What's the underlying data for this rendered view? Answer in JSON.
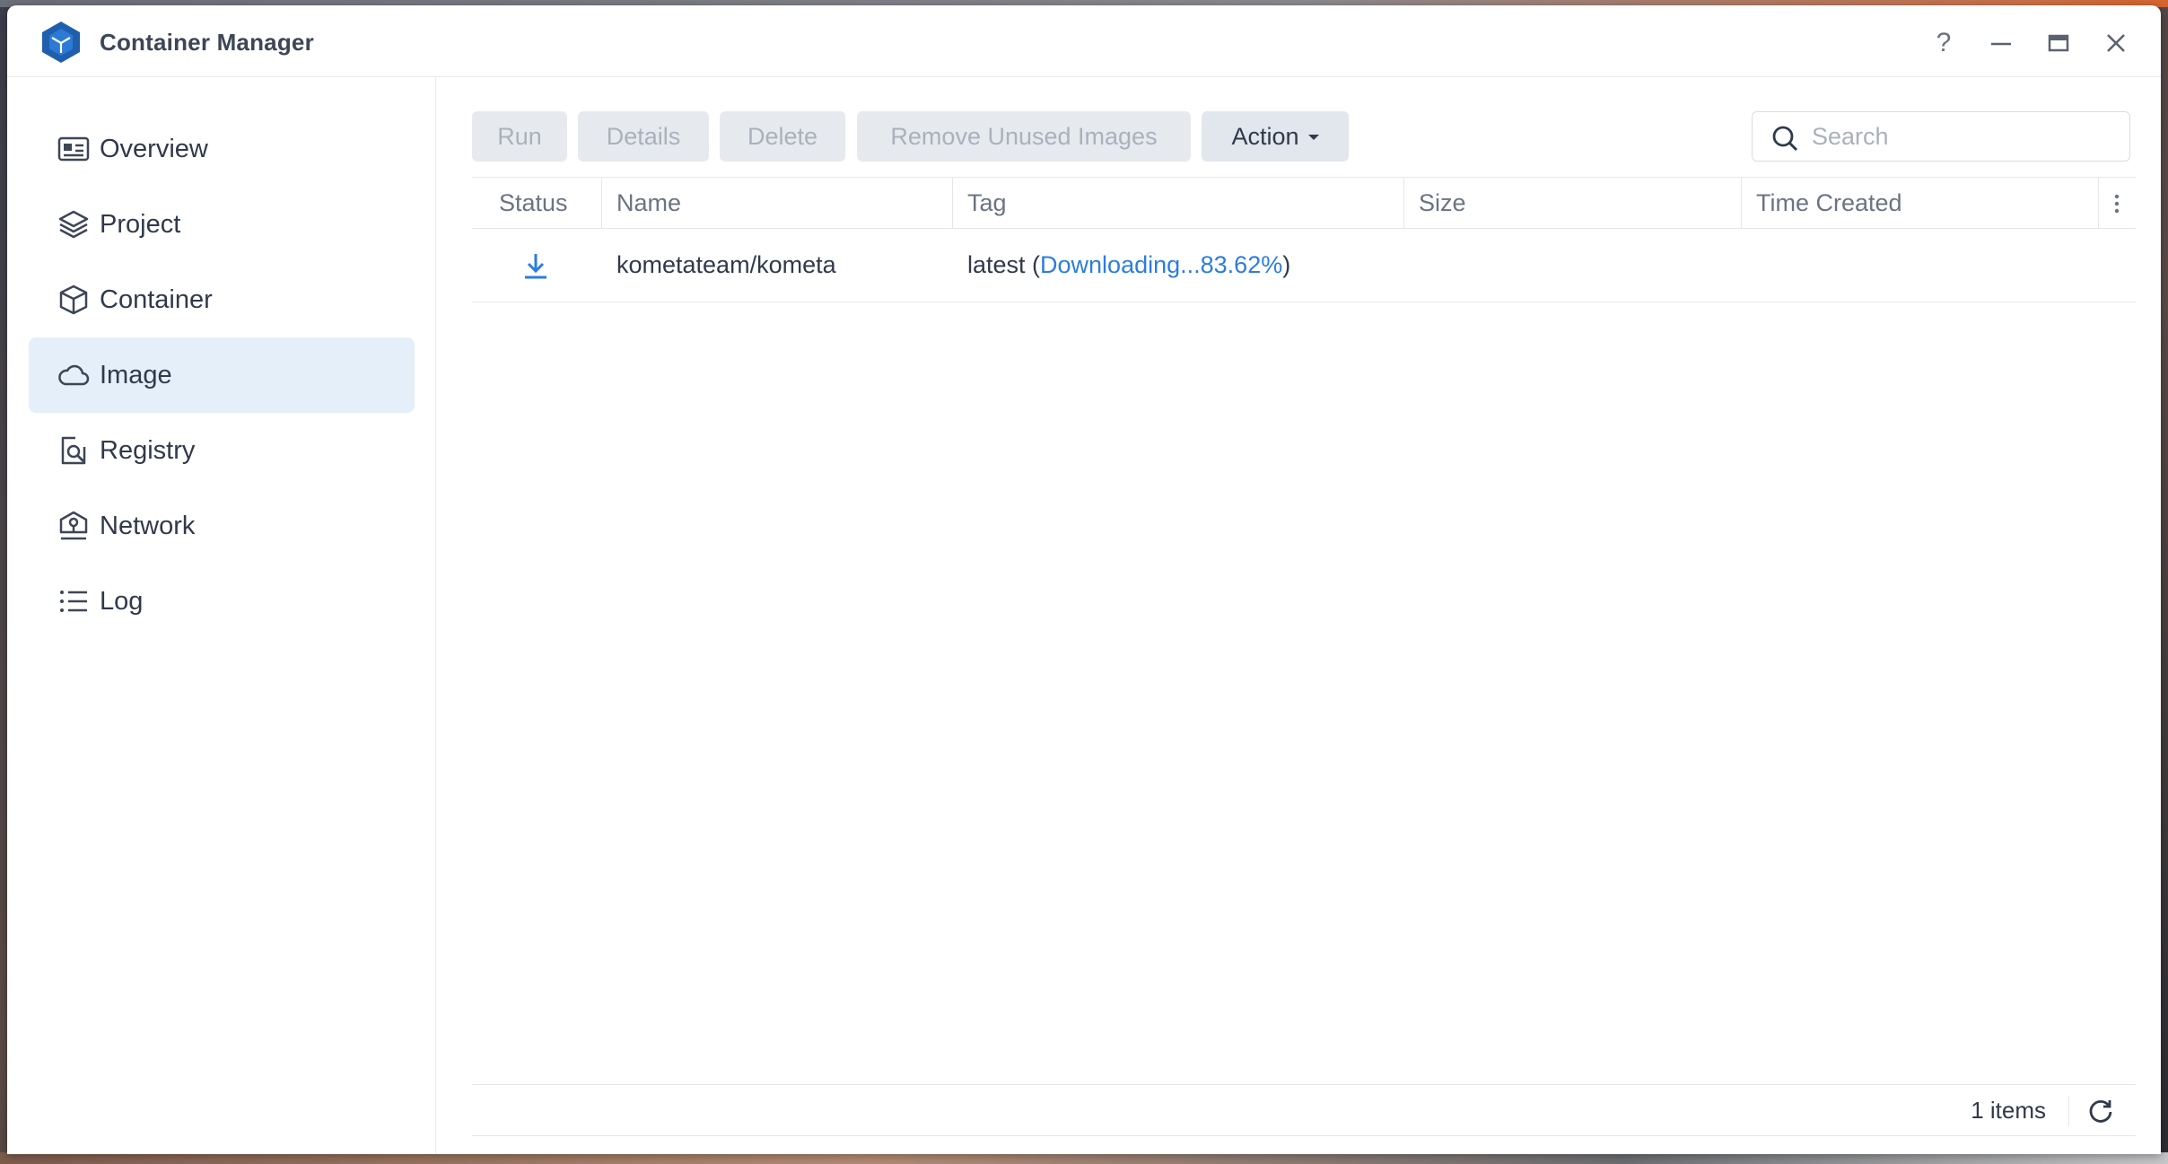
{
  "app": {
    "title": "Container Manager"
  },
  "window_controls": {
    "help": "?"
  },
  "sidebar": {
    "items": [
      {
        "label": "Overview",
        "icon": "overview-icon",
        "active": false
      },
      {
        "label": "Project",
        "icon": "layers-icon",
        "active": false
      },
      {
        "label": "Container",
        "icon": "cube-icon",
        "active": false
      },
      {
        "label": "Image",
        "icon": "cloud-icon",
        "active": true
      },
      {
        "label": "Registry",
        "icon": "registry-search-icon",
        "active": false
      },
      {
        "label": "Network",
        "icon": "network-icon",
        "active": false
      },
      {
        "label": "Log",
        "icon": "list-icon",
        "active": false
      }
    ]
  },
  "toolbar": {
    "run": "Run",
    "details": "Details",
    "delete": "Delete",
    "remove_unused": "Remove Unused Images",
    "action": "Action"
  },
  "search": {
    "placeholder": "Search"
  },
  "table": {
    "columns": [
      "Status",
      "Name",
      "Tag",
      "Size",
      "Time Created"
    ],
    "rows": [
      {
        "status_icon": "download-icon",
        "name": "kometateam/kometa",
        "tag_prefix": "latest (",
        "tag_progress": "Downloading...83.62%",
        "tag_suffix": ")",
        "size": "",
        "time_created": ""
      }
    ]
  },
  "footer": {
    "items_count": "1 items"
  },
  "colors": {
    "accent": "#2b7de0",
    "active_nav_bg": "#e5eff9",
    "logo": "#1f5fae"
  }
}
